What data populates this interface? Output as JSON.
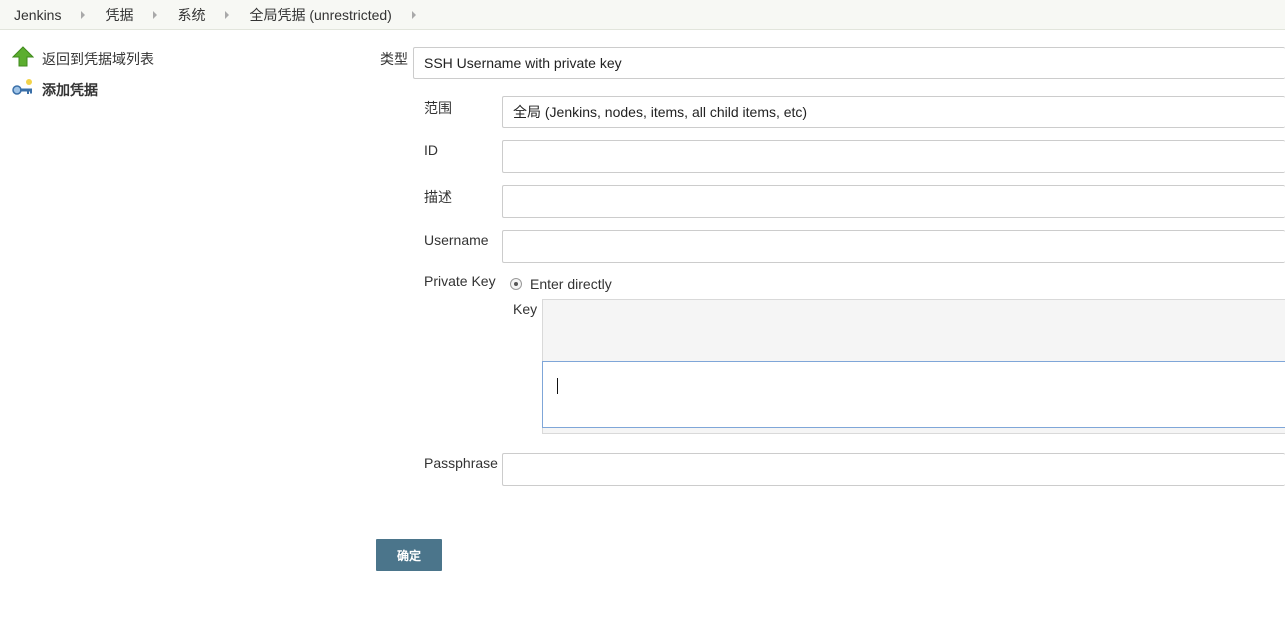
{
  "breadcrumb": {
    "items": [
      "Jenkins",
      "凭据",
      "系统",
      "全局凭据 (unrestricted)"
    ]
  },
  "sidebar": {
    "items": [
      {
        "label": "返回到凭据域列表",
        "icon": "up-arrow-icon"
      },
      {
        "label": "添加凭据",
        "icon": "key-icon"
      }
    ]
  },
  "form": {
    "kind_label": "类型",
    "kind_value": "SSH Username with private key",
    "scope_label": "范围",
    "scope_value": "全局 (Jenkins, nodes, items, all child items, etc)",
    "id_label": "ID",
    "id_value": "",
    "description_label": "描述",
    "description_value": "",
    "username_label": "Username",
    "username_value": "",
    "private_key_label": "Private Key",
    "private_key_option": "Enter directly",
    "key_label": "Key",
    "key_value": "",
    "passphrase_label": "Passphrase",
    "passphrase_value": "",
    "submit_label": "确定"
  },
  "colors": {
    "submit_button": "#4b758b",
    "breadcrumb_bg": "#f7f8f4",
    "focus_border": "#7fa6d8"
  }
}
